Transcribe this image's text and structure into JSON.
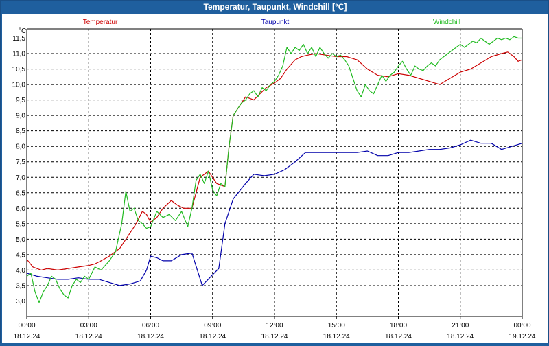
{
  "window": {
    "title": "Temperatur, Taupunkt, Windchill [°C]"
  },
  "colors": {
    "temperatur": "#cc0000",
    "taupunkt": "#0000aa",
    "windchill": "#22bb22",
    "title_bg": "#1f5f9e"
  },
  "chart_data": {
    "type": "line",
    "title": "Temperatur, Taupunkt, Windchill [°C]",
    "ylabel": "°C",
    "ylim": [
      2.5,
      11.8
    ],
    "grid": true,
    "y_ticks": [
      "3,0",
      "3,5",
      "4,0",
      "4,5",
      "5,0",
      "5,5",
      "6,0",
      "6,5",
      "7,0",
      "7,5",
      "8,0",
      "8,5",
      "9,0",
      "9,5",
      "10,0",
      "10,5",
      "11,0",
      "11,5"
    ],
    "x_ticks": [
      {
        "time": "00:00",
        "date": "18.12.24"
      },
      {
        "time": "03:00",
        "date": "18.12.24"
      },
      {
        "time": "06:00",
        "date": "18.12.24"
      },
      {
        "time": "09:00",
        "date": "18.12.24"
      },
      {
        "time": "12:00",
        "date": "18.12.24"
      },
      {
        "time": "15:00",
        "date": "18.12.24"
      },
      {
        "time": "18:00",
        "date": "18.12.24"
      },
      {
        "time": "21:00",
        "date": "18.12.24"
      },
      {
        "time": "00:00",
        "date": "19.12.24"
      }
    ],
    "xlim_hours": [
      0,
      24
    ],
    "series": [
      {
        "name": "Temperatur",
        "color": "#cc0000",
        "x": [
          0,
          0.3,
          0.7,
          1.0,
          1.5,
          2.0,
          2.5,
          3.0,
          3.3,
          3.6,
          4.0,
          4.5,
          5.0,
          5.3,
          5.6,
          5.8,
          6.0,
          6.3,
          6.6,
          7.0,
          7.3,
          7.6,
          8.0,
          8.4,
          8.8,
          9.2,
          9.6,
          9.8,
          10.0,
          10.3,
          10.6,
          11.0,
          11.3,
          11.6,
          12.0,
          12.3,
          12.6,
          13.0,
          13.3,
          13.6,
          14.0,
          14.5,
          15.0,
          15.5,
          16.0,
          16.5,
          17.0,
          17.5,
          18.0,
          18.5,
          19.0,
          19.5,
          20.0,
          20.5,
          21.0,
          21.5,
          22.0,
          22.5,
          23.0,
          23.3,
          23.6,
          23.8,
          24.0
        ],
        "y": [
          4.35,
          4.1,
          4.0,
          4.05,
          4.0,
          4.05,
          4.1,
          4.15,
          4.2,
          4.3,
          4.45,
          4.7,
          5.2,
          5.5,
          5.9,
          5.8,
          5.55,
          5.7,
          6.0,
          6.25,
          6.1,
          6.0,
          6.0,
          7.0,
          7.2,
          6.8,
          6.7,
          8.0,
          9.0,
          9.3,
          9.6,
          9.5,
          9.7,
          9.9,
          10.05,
          10.2,
          10.5,
          10.8,
          10.9,
          10.95,
          11.0,
          10.95,
          10.9,
          10.9,
          10.8,
          10.5,
          10.3,
          10.25,
          10.35,
          10.3,
          10.2,
          10.1,
          10.0,
          10.2,
          10.4,
          10.5,
          10.7,
          10.9,
          11.0,
          11.05,
          10.9,
          10.75,
          10.8
        ]
      },
      {
        "name": "Taupunkt",
        "color": "#0000aa",
        "x": [
          0,
          0.5,
          1.0,
          1.5,
          2.0,
          2.5,
          3.0,
          3.5,
          4.0,
          4.5,
          5.0,
          5.5,
          5.8,
          6.0,
          6.3,
          6.6,
          7.0,
          7.5,
          8.0,
          8.5,
          9.0,
          9.3,
          9.6,
          10.0,
          10.3,
          10.6,
          11.0,
          11.5,
          12.0,
          12.5,
          13.0,
          13.5,
          14.0,
          14.5,
          15.0,
          15.5,
          16.0,
          16.5,
          17.0,
          17.5,
          18.0,
          18.5,
          19.0,
          19.5,
          20.0,
          20.5,
          21.0,
          21.5,
          22.0,
          22.5,
          23.0,
          23.5,
          24.0
        ],
        "y": [
          3.9,
          3.8,
          3.75,
          3.7,
          3.7,
          3.75,
          3.7,
          3.7,
          3.6,
          3.5,
          3.55,
          3.65,
          4.0,
          4.45,
          4.4,
          4.3,
          4.3,
          4.5,
          4.55,
          3.5,
          3.85,
          4.05,
          5.5,
          6.3,
          6.55,
          6.8,
          7.1,
          7.05,
          7.1,
          7.25,
          7.5,
          7.8,
          7.8,
          7.8,
          7.8,
          7.8,
          7.8,
          7.85,
          7.7,
          7.7,
          7.8,
          7.8,
          7.85,
          7.9,
          7.9,
          7.95,
          8.05,
          8.2,
          8.1,
          8.1,
          7.9,
          8.0,
          8.1
        ]
      },
      {
        "name": "Windchill",
        "color": "#22bb22",
        "x": [
          0,
          0.2,
          0.4,
          0.6,
          0.8,
          1.0,
          1.2,
          1.4,
          1.6,
          1.8,
          2.0,
          2.2,
          2.4,
          2.6,
          2.8,
          3.0,
          3.3,
          3.6,
          4.0,
          4.3,
          4.6,
          4.8,
          5.0,
          5.2,
          5.4,
          5.6,
          5.8,
          6.0,
          6.3,
          6.6,
          6.9,
          7.2,
          7.5,
          7.8,
          8.0,
          8.2,
          8.4,
          8.6,
          8.8,
          9.0,
          9.2,
          9.4,
          9.6,
          9.8,
          10.0,
          10.2,
          10.4,
          10.6,
          10.8,
          11.0,
          11.2,
          11.4,
          11.6,
          11.8,
          12.0,
          12.2,
          12.4,
          12.6,
          12.8,
          13.0,
          13.2,
          13.4,
          13.6,
          13.8,
          14.0,
          14.2,
          14.4,
          14.6,
          14.8,
          15.0,
          15.2,
          15.4,
          15.6,
          15.8,
          16.0,
          16.2,
          16.4,
          16.6,
          16.8,
          17.0,
          17.2,
          17.4,
          17.6,
          17.8,
          18.0,
          18.2,
          18.4,
          18.6,
          18.8,
          19.0,
          19.2,
          19.4,
          19.6,
          19.8,
          20.0,
          20.2,
          20.4,
          20.6,
          20.8,
          21.0,
          21.2,
          21.4,
          21.6,
          21.8,
          22.0,
          22.2,
          22.4,
          22.6,
          22.8,
          23.0,
          23.2,
          23.4,
          23.6,
          23.8,
          24.0
        ],
        "y": [
          3.8,
          3.9,
          3.3,
          2.95,
          3.3,
          3.5,
          3.8,
          3.7,
          3.4,
          3.2,
          3.1,
          3.5,
          3.7,
          3.6,
          3.8,
          3.7,
          4.1,
          4.0,
          4.3,
          4.6,
          5.5,
          6.55,
          5.9,
          6.0,
          5.6,
          5.5,
          5.35,
          5.4,
          5.9,
          5.7,
          5.8,
          5.6,
          5.9,
          5.4,
          6.0,
          6.9,
          7.1,
          6.8,
          7.2,
          6.6,
          6.4,
          6.8,
          6.7,
          8.0,
          9.0,
          9.2,
          9.4,
          9.5,
          9.7,
          9.8,
          9.6,
          9.9,
          9.8,
          10.0,
          10.1,
          10.3,
          10.6,
          11.2,
          11.0,
          11.2,
          11.1,
          11.3,
          11.0,
          11.2,
          10.9,
          11.2,
          11.0,
          10.85,
          11.0,
          10.9,
          10.95,
          10.8,
          10.6,
          10.2,
          9.8,
          9.6,
          10.0,
          9.8,
          9.7,
          10.0,
          10.3,
          10.1,
          10.3,
          10.4,
          10.6,
          10.75,
          10.5,
          10.3,
          10.6,
          10.5,
          10.45,
          10.6,
          10.7,
          10.6,
          10.8,
          10.9,
          11.0,
          11.1,
          11.2,
          11.3,
          11.2,
          11.3,
          11.4,
          11.35,
          11.5,
          11.4,
          11.3,
          11.4,
          11.5,
          11.45,
          11.5,
          11.45,
          11.55,
          11.5,
          11.5
        ]
      }
    ]
  }
}
